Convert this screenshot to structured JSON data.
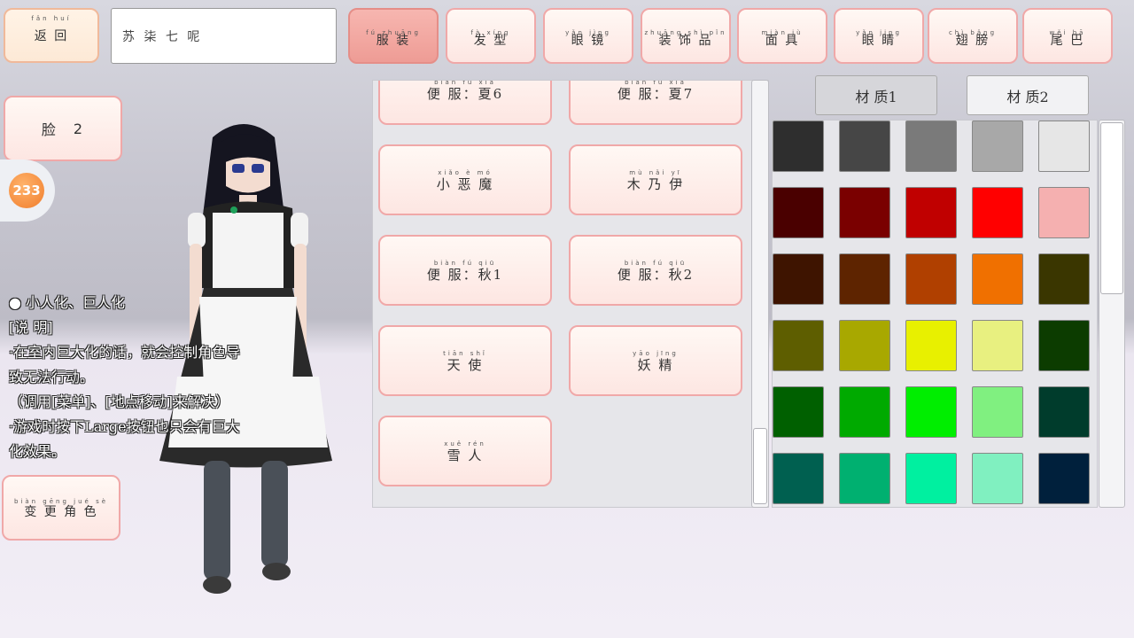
{
  "topbar": {
    "back_label": "返 回",
    "back_pinyin": "fǎn huí",
    "search_value": "苏 柒 七 呢",
    "search_pinyin": "sū  qī  qī  ní",
    "tabs": [
      {
        "label": "服 装",
        "pinyin": "fú zhuāng"
      },
      {
        "label": "发 型",
        "pinyin": "fà xíng"
      },
      {
        "label": "眼 镜",
        "pinyin": "yǎn jìng"
      },
      {
        "label": "装 饰 品",
        "pinyin": "zhuāng shì pǐn"
      },
      {
        "label": "面 具",
        "pinyin": "miàn jù"
      },
      {
        "label": "眼 睛",
        "pinyin": "yǎn jing"
      },
      {
        "label": "翅 膀",
        "pinyin": "chì bǎng"
      },
      {
        "label": "尾 巴",
        "pinyin": "wěi bā"
      }
    ]
  },
  "left": {
    "face_label": "脸",
    "face_value": "2",
    "badge": "233",
    "change_label": "变 更 角 色",
    "change_pinyin": "biàn gēng jué sè"
  },
  "description": {
    "line1": "● 小人化、巨人化",
    "line2": "[说 明]",
    "line3": "·在室内巨大化的话，就会控制角色导",
    "line4": "致无法行动。",
    "line5": "（调用[菜单]、[地点移动]来解决）",
    "line6": "·游戏时按下Large按钮也只会有巨大",
    "line7": "化效果。"
  },
  "outfits": [
    {
      "label": "便 服：夏6",
      "pinyin": "biàn fú   xià"
    },
    {
      "label": "便 服：夏7",
      "pinyin": "biàn fú   xià"
    },
    {
      "label": "小 恶 魔",
      "pinyin": "xiǎo è mó"
    },
    {
      "label": "木 乃 伊",
      "pinyin": "mù nǎi yī"
    },
    {
      "label": "便 服：秋1",
      "pinyin": "biàn fú   qiū"
    },
    {
      "label": "便 服：秋2",
      "pinyin": "biàn fú   qiū"
    },
    {
      "label": "天 使",
      "pinyin": "tiān shǐ"
    },
    {
      "label": "妖 精",
      "pinyin": "yāo jīng"
    },
    {
      "label": "雪 人",
      "pinyin": "xuě rén"
    }
  ],
  "materials": [
    {
      "label": "材 质1",
      "pinyin": "cái zhì"
    },
    {
      "label": "材 质2",
      "pinyin": "cái zhì"
    }
  ],
  "swatches": [
    "#2e2e2e",
    "#464646",
    "#7a7a7a",
    "#a8a8a8",
    "#e6e6e6",
    "#4a0000",
    "#7a0000",
    "#c00000",
    "#ff0000",
    "#f5b0b0",
    "#3e1400",
    "#5e2400",
    "#b04000",
    "#f07000",
    "#3a3600",
    "#5e5e00",
    "#a8a800",
    "#e8f000",
    "#e8f080",
    "#0c3c00",
    "#006000",
    "#00aa00",
    "#00ee00",
    "#80f080",
    "#003c2c",
    "#006050",
    "#00b070",
    "#00f0a0",
    "#80f0c0",
    "#00203c"
  ]
}
